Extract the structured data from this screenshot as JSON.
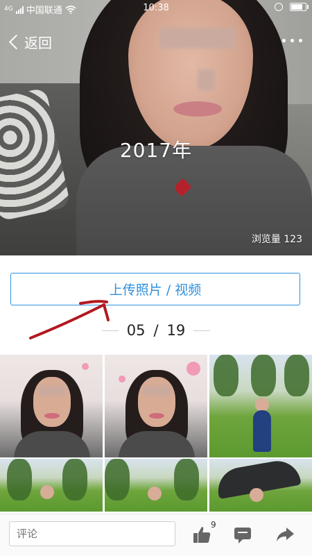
{
  "status_bar": {
    "network_type": "4G",
    "carrier": "中国联通",
    "time": "10:38"
  },
  "nav": {
    "back_label": "返回"
  },
  "album": {
    "title": "2017年",
    "view_count_label": "浏览量 123"
  },
  "upload": {
    "label": "上传照片 / 视频"
  },
  "pager": {
    "current": "05",
    "separator": "/",
    "total": "19"
  },
  "photos": [
    {
      "type": "portrait"
    },
    {
      "type": "portrait"
    },
    {
      "type": "outdoor-child"
    },
    {
      "type": "outdoor-child"
    },
    {
      "type": "outdoor-child"
    },
    {
      "type": "outdoor-child-umbrella"
    }
  ],
  "bottom_bar": {
    "comment_placeholder": "评论",
    "like_count": "9",
    "icons": [
      "thumbs-up-icon",
      "comment-icon",
      "share-icon"
    ]
  },
  "colors": {
    "accent": "#2f8fdc",
    "annotation_arrow": "#b3181f"
  }
}
